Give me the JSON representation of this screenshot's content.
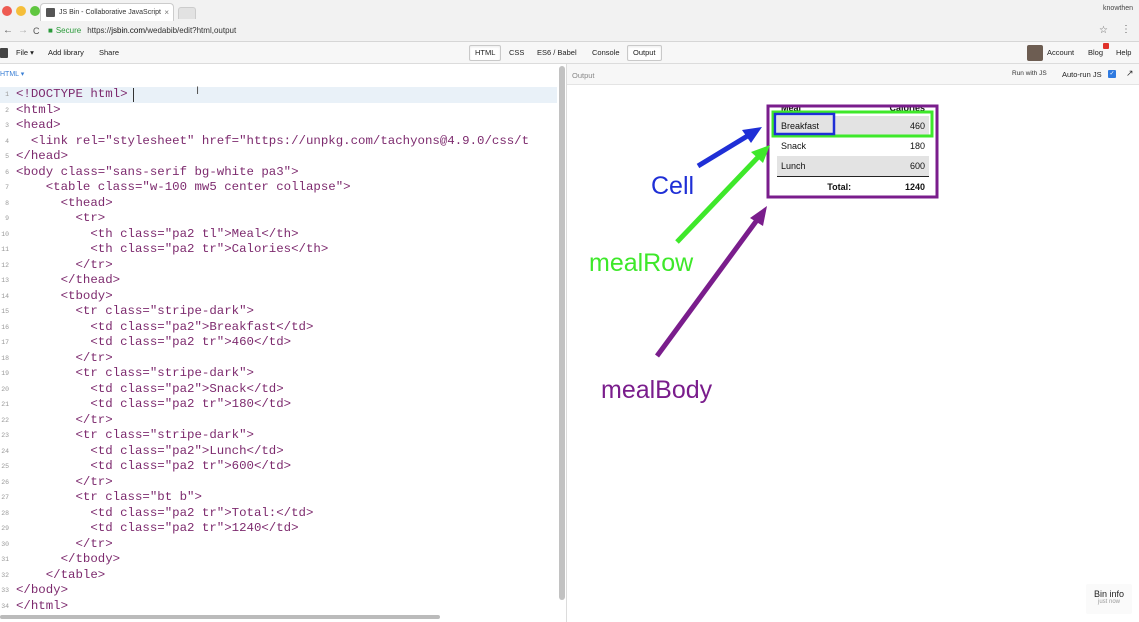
{
  "browser": {
    "tab_title": "JS Bin - Collaborative JavaScript",
    "tab_close": "×",
    "secure_label": "Secure",
    "url_scheme": "https://",
    "url_host": "jsbin.com",
    "url_path": "/wedabib/edit?html,output",
    "profile_label": "knowthen",
    "back": "←",
    "forward": "→",
    "reload": "C",
    "star": "☆",
    "menu": "⋮"
  },
  "toolbar": {
    "file": "File ▾",
    "add_library": "Add library",
    "share": "Share",
    "panels": [
      "HTML",
      "CSS",
      "ES6 / Babel",
      "Console",
      "Output"
    ],
    "account": "Account",
    "blog": "Blog",
    "blog_badge": "1",
    "help": "Help"
  },
  "editor": {
    "mode_label": "HTML ▾",
    "lines": [
      "<!DOCTYPE html>",
      "<html>",
      "<head>",
      "  <link rel=\"stylesheet\" href=\"https://unpkg.com/tachyons@4.9.0/css/t",
      "</head>",
      "<body class=\"sans-serif bg-white pa3\">",
      "    <table class=\"w-100 mw5 center collapse\">",
      "      <thead>",
      "        <tr>",
      "          <th class=\"pa2 tl\">Meal</th>",
      "          <th class=\"pa2 tr\">Calories</th>",
      "        </tr>",
      "      </thead>",
      "      <tbody>",
      "        <tr class=\"stripe-dark\">",
      "          <td class=\"pa2\">Breakfast</td>",
      "          <td class=\"pa2 tr\">460</td>",
      "        </tr>",
      "        <tr class=\"stripe-dark\">",
      "          <td class=\"pa2\">Snack</td>",
      "          <td class=\"pa2 tr\">180</td>",
      "        </tr>",
      "        <tr class=\"stripe-dark\">",
      "          <td class=\"pa2\">Lunch</td>",
      "          <td class=\"pa2 tr\">600</td>",
      "        </tr>",
      "        <tr class=\"bt b\">",
      "          <td class=\"pa2 tr\">Total:</td>",
      "          <td class=\"pa2 tr\">1240</td>",
      "        </tr>",
      "      </tbody>",
      "    </table>",
      "</body>",
      "</html>"
    ]
  },
  "output": {
    "label": "Output",
    "run_js": "Run with JS",
    "auto_run": "Auto-run JS",
    "table": {
      "headers": [
        "Meal",
        "Calories"
      ],
      "rows": [
        {
          "meal": "Breakfast",
          "calories": "460"
        },
        {
          "meal": "Snack",
          "calories": "180"
        },
        {
          "meal": "Lunch",
          "calories": "600"
        }
      ],
      "total_label": "Total:",
      "total_value": "1240"
    },
    "annotations": {
      "cell": {
        "label": "Cell",
        "color": "#1f2fd6"
      },
      "meal_row": {
        "label": "mealRow",
        "color": "#3ee82a"
      },
      "meal_body": {
        "label": "mealBody",
        "color": "#7a1d8c"
      }
    }
  },
  "bin_info": {
    "title": "Bin info",
    "subtitle": "just now"
  }
}
